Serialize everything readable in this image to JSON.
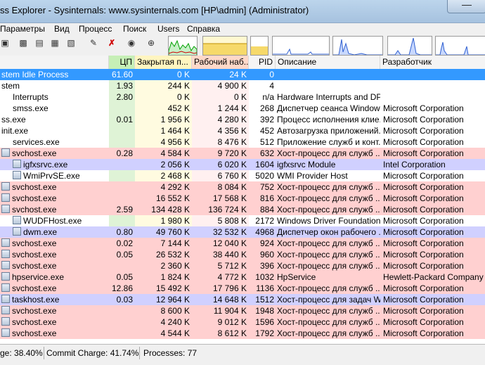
{
  "window": {
    "title": "ss Explorer - Sysinternals: www.sysinternals.com [HP\\admin] (Administrator)"
  },
  "menu": [
    "Параметры",
    "Вид",
    "Процесс",
    "Поиск",
    "Users",
    "Справка"
  ],
  "toolbar": {
    "icons": [
      "refresh-icon",
      "system-info-icon",
      "properties-icon",
      "lower-pane-icon",
      "dll-icon",
      "find-window-icon",
      "kill-process-icon",
      "find-icon",
      "target-icon"
    ]
  },
  "columns": {
    "cpu": "ЦП",
    "private": "Закрытая п...",
    "working": "Рабочий наб...",
    "pid": "PID",
    "description": "Описание",
    "company": "Разработчик"
  },
  "colors": {
    "highlight": "#3399ff",
    "service": "#ffd0d0",
    "own": "#d0d0ff",
    "cpu_col": "#dff3d6",
    "private_col": "#fffbe0",
    "working_col": "#fff0f0"
  },
  "processes": [
    {
      "name": "stem Idle Process",
      "cpu": "61.60",
      "private": "0 K",
      "working": "24 K",
      "pid": "0",
      "description": "",
      "company": "",
      "bg": "highlight",
      "indent": 0,
      "icon": false
    },
    {
      "name": "stem",
      "cpu": "1.93",
      "private": "244 K",
      "working": "4 900 K",
      "pid": "4",
      "description": "",
      "company": "",
      "bg": "",
      "indent": 0,
      "icon": false
    },
    {
      "name": "Interrupts",
      "cpu": "2.80",
      "private": "0 K",
      "working": "0 K",
      "pid": "n/a",
      "description": "Hardware Interrupts and DPCs",
      "company": "",
      "bg": "",
      "indent": 1,
      "icon": false
    },
    {
      "name": "smss.exe",
      "cpu": "",
      "private": "452 K",
      "working": "1 244 K",
      "pid": "268",
      "description": "Диспетчер сеанса  Windows",
      "company": "Microsoft Corporation",
      "bg": "",
      "indent": 1,
      "icon": false
    },
    {
      "name": "ss.exe",
      "cpu": "0.01",
      "private": "1 956 K",
      "working": "4 280 K",
      "pid": "392",
      "description": "Процесс исполнения клие...",
      "company": "Microsoft Corporation",
      "bg": "",
      "indent": 0,
      "icon": false
    },
    {
      "name": "init.exe",
      "cpu": "",
      "private": "1 464 K",
      "working": "4 356 K",
      "pid": "452",
      "description": "Автозагрузка приложений...",
      "company": "Microsoft Corporation",
      "bg": "",
      "indent": 0,
      "icon": false
    },
    {
      "name": "services.exe",
      "cpu": "",
      "private": "4 956 K",
      "working": "8 476 K",
      "pid": "512",
      "description": "Приложение служб и конт...",
      "company": "Microsoft Corporation",
      "bg": "",
      "indent": 1,
      "icon": false
    },
    {
      "name": "svchost.exe",
      "cpu": "0.28",
      "private": "4 584 K",
      "working": "9 720 K",
      "pid": "632",
      "description": "Хост-процесс для служб ...",
      "company": "Microsoft Corporation",
      "bg": "service",
      "indent": 0,
      "icon": true
    },
    {
      "name": "igfxsrvc.exe",
      "cpu": "",
      "private": "2 056 K",
      "working": "6 020 K",
      "pid": "1604",
      "description": "igfxsrvc Module",
      "company": "Intel Corporation",
      "bg": "own",
      "indent": 1,
      "icon": true
    },
    {
      "name": "WmiPrvSE.exe",
      "cpu": "",
      "private": "2 468 K",
      "working": "6 760 K",
      "pid": "5020",
      "description": "WMI Provider Host",
      "company": "Microsoft Corporation",
      "bg": "",
      "indent": 1,
      "icon": true
    },
    {
      "name": "svchost.exe",
      "cpu": "",
      "private": "4 292 K",
      "working": "8 084 K",
      "pid": "752",
      "description": "Хост-процесс для служб ...",
      "company": "Microsoft Corporation",
      "bg": "service",
      "indent": 0,
      "icon": true
    },
    {
      "name": "svchost.exe",
      "cpu": "",
      "private": "16 552 K",
      "working": "17 568 K",
      "pid": "816",
      "description": "Хост-процесс для служб ...",
      "company": "Microsoft Corporation",
      "bg": "service",
      "indent": 0,
      "icon": true
    },
    {
      "name": "svchost.exe",
      "cpu": "2.59",
      "private": "134 428 K",
      "working": "136 724 K",
      "pid": "884",
      "description": "Хост-процесс для служб ...",
      "company": "Microsoft Corporation",
      "bg": "service",
      "indent": 0,
      "icon": true
    },
    {
      "name": "WUDFHost.exe",
      "cpu": "",
      "private": "1 980 K",
      "working": "5 808 K",
      "pid": "2172",
      "description": "Windows Driver Foundation (...",
      "company": "Microsoft Corporation",
      "bg": "",
      "indent": 1,
      "icon": true
    },
    {
      "name": "dwm.exe",
      "cpu": "0.80",
      "private": "49 760 K",
      "working": "32 532 K",
      "pid": "4968",
      "description": "Диспетчер окон рабочего ...",
      "company": "Microsoft Corporation",
      "bg": "own",
      "indent": 1,
      "icon": true
    },
    {
      "name": "svchost.exe",
      "cpu": "0.02",
      "private": "7 144 K",
      "working": "12 040 K",
      "pid": "924",
      "description": "Хост-процесс для служб ...",
      "company": "Microsoft Corporation",
      "bg": "service",
      "indent": 0,
      "icon": true
    },
    {
      "name": "svchost.exe",
      "cpu": "0.05",
      "private": "26 532 K",
      "working": "38 440 K",
      "pid": "960",
      "description": "Хост-процесс для служб ...",
      "company": "Microsoft Corporation",
      "bg": "service",
      "indent": 0,
      "icon": true
    },
    {
      "name": "svchost.exe",
      "cpu": "",
      "private": "2 360 K",
      "working": "5 712 K",
      "pid": "396",
      "description": "Хост-процесс для служб ...",
      "company": "Microsoft Corporation",
      "bg": "service",
      "indent": 0,
      "icon": true
    },
    {
      "name": "hpservice.exe",
      "cpu": "0.05",
      "private": "1 824 K",
      "working": "4 772 K",
      "pid": "1032",
      "description": "HpService",
      "company": "Hewlett-Packard Company",
      "bg": "service",
      "indent": 0,
      "icon": true
    },
    {
      "name": "svchost.exe",
      "cpu": "12.86",
      "private": "15 492 K",
      "working": "17 796 K",
      "pid": "1136",
      "description": "Хост-процесс для служб ...",
      "company": "Microsoft Corporation",
      "bg": "service",
      "indent": 0,
      "icon": true
    },
    {
      "name": "taskhost.exe",
      "cpu": "0.03",
      "private": "12 964 K",
      "working": "14 648 K",
      "pid": "1512",
      "description": "Хост-процесс для задач W...",
      "company": "Microsoft Corporation",
      "bg": "own",
      "indent": 0,
      "icon": true
    },
    {
      "name": "svchost.exe",
      "cpu": "",
      "private": "8 600 K",
      "working": "11 904 K",
      "pid": "1948",
      "description": "Хост-процесс для служб ...",
      "company": "Microsoft Corporation",
      "bg": "service",
      "indent": 0,
      "icon": true
    },
    {
      "name": "svchost.exe",
      "cpu": "",
      "private": "4 240 K",
      "working": "9 012 K",
      "pid": "1596",
      "description": "Хост-процесс для служб ...",
      "company": "Microsoft Corporation",
      "bg": "service",
      "indent": 0,
      "icon": true
    },
    {
      "name": "svchost.exe",
      "cpu": "",
      "private": "4 544 K",
      "working": "8 612 K",
      "pid": "1792",
      "description": "Хост-процесс для служб ...",
      "company": "Microsoft Corporation",
      "bg": "service",
      "indent": 0,
      "icon": true
    }
  ],
  "status": {
    "usage": "ge: 38.40%",
    "commit": "Commit Charge: 41.74%",
    "processes": "Processes: 77"
  }
}
